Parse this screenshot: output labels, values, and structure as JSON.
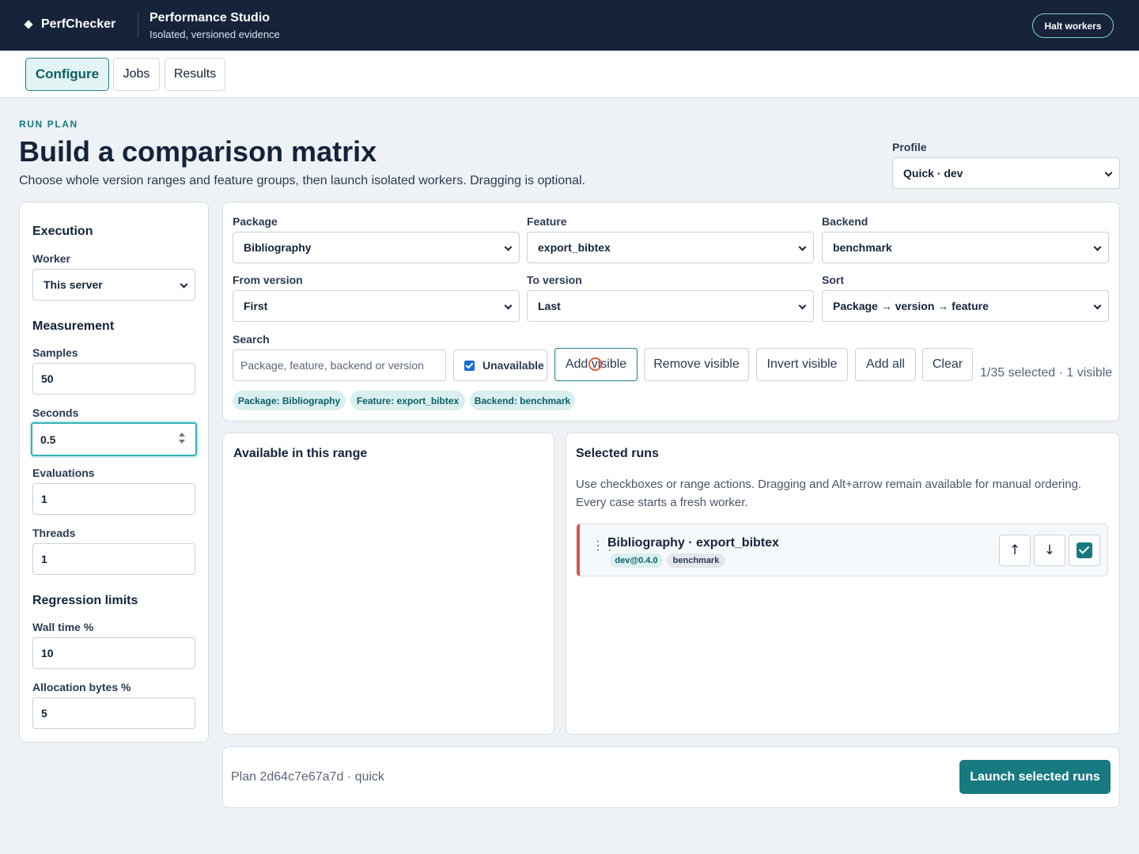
{
  "header": {
    "brand": "PerfChecker",
    "studio_title": "Performance Studio",
    "studio_subtitle": "Isolated, versioned evidence",
    "halt_label": "Halt workers"
  },
  "tabs": [
    {
      "label": "Configure",
      "active": true
    },
    {
      "label": "Jobs",
      "active": false
    },
    {
      "label": "Results",
      "active": false
    }
  ],
  "intro": {
    "eyebrow": "RUN PLAN",
    "title": "Build a comparison matrix",
    "lead": "Choose whole version ranges and feature groups, then launch isolated workers. Dragging is optional."
  },
  "profile": {
    "label": "Profile",
    "value": "Quick · dev"
  },
  "sidebar": {
    "execution_title": "Execution",
    "worker_label": "Worker",
    "worker_value": "This server",
    "measurement_title": "Measurement",
    "samples_label": "Samples",
    "samples_value": "50",
    "seconds_label": "Seconds",
    "seconds_value": "0.5",
    "evaluations_label": "Evaluations",
    "evaluations_value": "1",
    "threads_label": "Threads",
    "threads_value": "1",
    "regression_title": "Regression limits",
    "wall_label": "Wall time %",
    "wall_value": "10",
    "alloc_label": "Allocation bytes %",
    "alloc_value": "5"
  },
  "filters": {
    "package_label": "Package",
    "package_value": "Bibliography",
    "feature_label": "Feature",
    "feature_value": "export_bibtex",
    "backend_label": "Backend",
    "backend_value": "benchmark",
    "from_label": "From version",
    "from_value": "First",
    "to_label": "To version",
    "to_value": "Last",
    "sort_label": "Sort",
    "sort_value": "Package → version → feature",
    "search_label": "Search",
    "search_placeholder": "Package, feature, backend or version",
    "unavailable_label": "Unavailable",
    "actions": {
      "add_visible": "Add visible",
      "remove_visible": "Remove visible",
      "invert_visible": "Invert visible",
      "add_all": "Add all",
      "clear": "Clear"
    },
    "count": "1/35 selected · 1 visible",
    "chips": [
      "Package: Bibliography",
      "Feature: export_bibtex",
      "Backend: benchmark"
    ]
  },
  "available": {
    "title": "Available in this range"
  },
  "selected": {
    "title": "Selected runs",
    "help": "Use checkboxes or range actions. Dragging and Alt+arrow remain available for manual ordering. Every case starts a fresh worker.",
    "runs": [
      {
        "title": "Bibliography · export_bibtex",
        "version": "dev@0.4.0",
        "backend": "benchmark",
        "up": "↑",
        "down": "↓"
      }
    ]
  },
  "footer": {
    "plan": "Plan 2d64c7e67a7d · quick",
    "launch_label": "Launch selected runs"
  },
  "colors": {
    "accent": "#177a80",
    "header": "#16233a",
    "run_marker": "#d9534f"
  }
}
